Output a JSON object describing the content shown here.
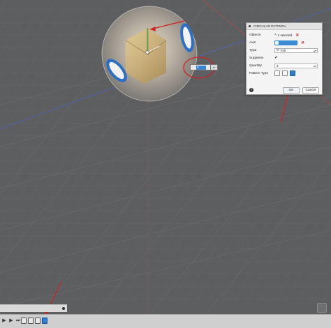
{
  "dialog": {
    "title": "CIRCULAR PATTERN",
    "rows": {
      "objects_label": "Objects",
      "objects_value": "1 selected",
      "axis_label": "Axis",
      "type_label": "Type",
      "type_value": "Full",
      "suppress_label": "Suppress",
      "quantity_label": "Quantity",
      "quantity_value": "3",
      "pattern_type_label": "Pattern Type"
    },
    "ok_label": "OK",
    "cancel_label": "Cancel",
    "help_glyph": "?",
    "clear_glyph": "✕"
  },
  "inline_quantity": {
    "value": "3"
  },
  "icons": {
    "objects": "cursor-select-icon",
    "axis": "axis-select-icon",
    "type": "pattern-type-icon",
    "suppress": "suppress-checkmark-icon",
    "help": "help-icon"
  },
  "colors": {
    "viewport_bg": "#5d5e60",
    "grid": "#6d6e70",
    "annotation_red": "#d32020",
    "selection_blue": "#3a86d6",
    "hole_blue": "#2d6fc4",
    "sphere_gold": "#c9a76a"
  }
}
